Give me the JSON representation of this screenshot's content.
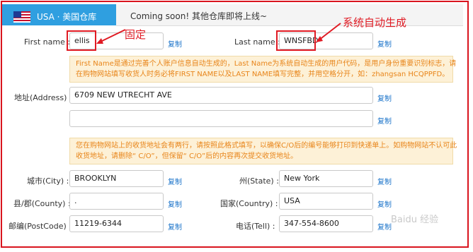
{
  "header": {
    "region_label": "USA · 美国仓库",
    "notice": "Coming soon! 其他仓库即将上线~"
  },
  "form": {
    "first_name": {
      "label": "First name :",
      "value": "ellis",
      "copy": "复制"
    },
    "last_name": {
      "label": "Last name :",
      "value": "WNSFBD",
      "copy": "复制"
    },
    "info_name": {
      "line1": "First Name是通过完善个人账户信息自动生成的，Last Name为系统自动生成的用户代码，是用户身份重要识别标志，请",
      "line2": "在购物网站填写收货人时务必将FIRST NAME以及LAST NAME填写完整，并用空格分开，如：zhangsan HCQPPFD。"
    },
    "address": {
      "label": "地址(Address) :",
      "line1": "6709 NEW UTRECHT AVE",
      "line2": "",
      "copy": "复制"
    },
    "info_address": {
      "line1": "您在购物网站上的收货地址会有两行，请按照此格式填写，以确保C/O后的编号能够打印到快递单上。如购物网站不认可此",
      "line2": "收货地址，请删除“ C/O”，但保留“ C/O”后的内容再次提交收货地址。"
    },
    "city": {
      "label": "城市(City) :",
      "value": "BROOKLYN",
      "copy": "复制"
    },
    "state": {
      "label": "州(State) :",
      "value": "New York",
      "copy": "复制"
    },
    "county": {
      "label": "县/郡(County) :",
      "value": ".",
      "copy": "复制"
    },
    "country": {
      "label": "国家(Country) :",
      "value": "USA",
      "copy": "复制"
    },
    "postcode": {
      "label": "邮编(PostCode) :",
      "value": "11219-6344",
      "copy": "复制"
    },
    "tell": {
      "label": "电话(Tell) :",
      "value": "347-554-8600",
      "copy": "复制"
    }
  },
  "annotations": {
    "fixed": "固定",
    "auto": "系统自动生成"
  },
  "watermark": "Baidu 经验",
  "colors": {
    "frame": "#d9141e",
    "tab_active": "#2f9fe0",
    "link": "#1a73c9",
    "info_text": "#e8851a",
    "info_bg": "#fdf1d7"
  }
}
